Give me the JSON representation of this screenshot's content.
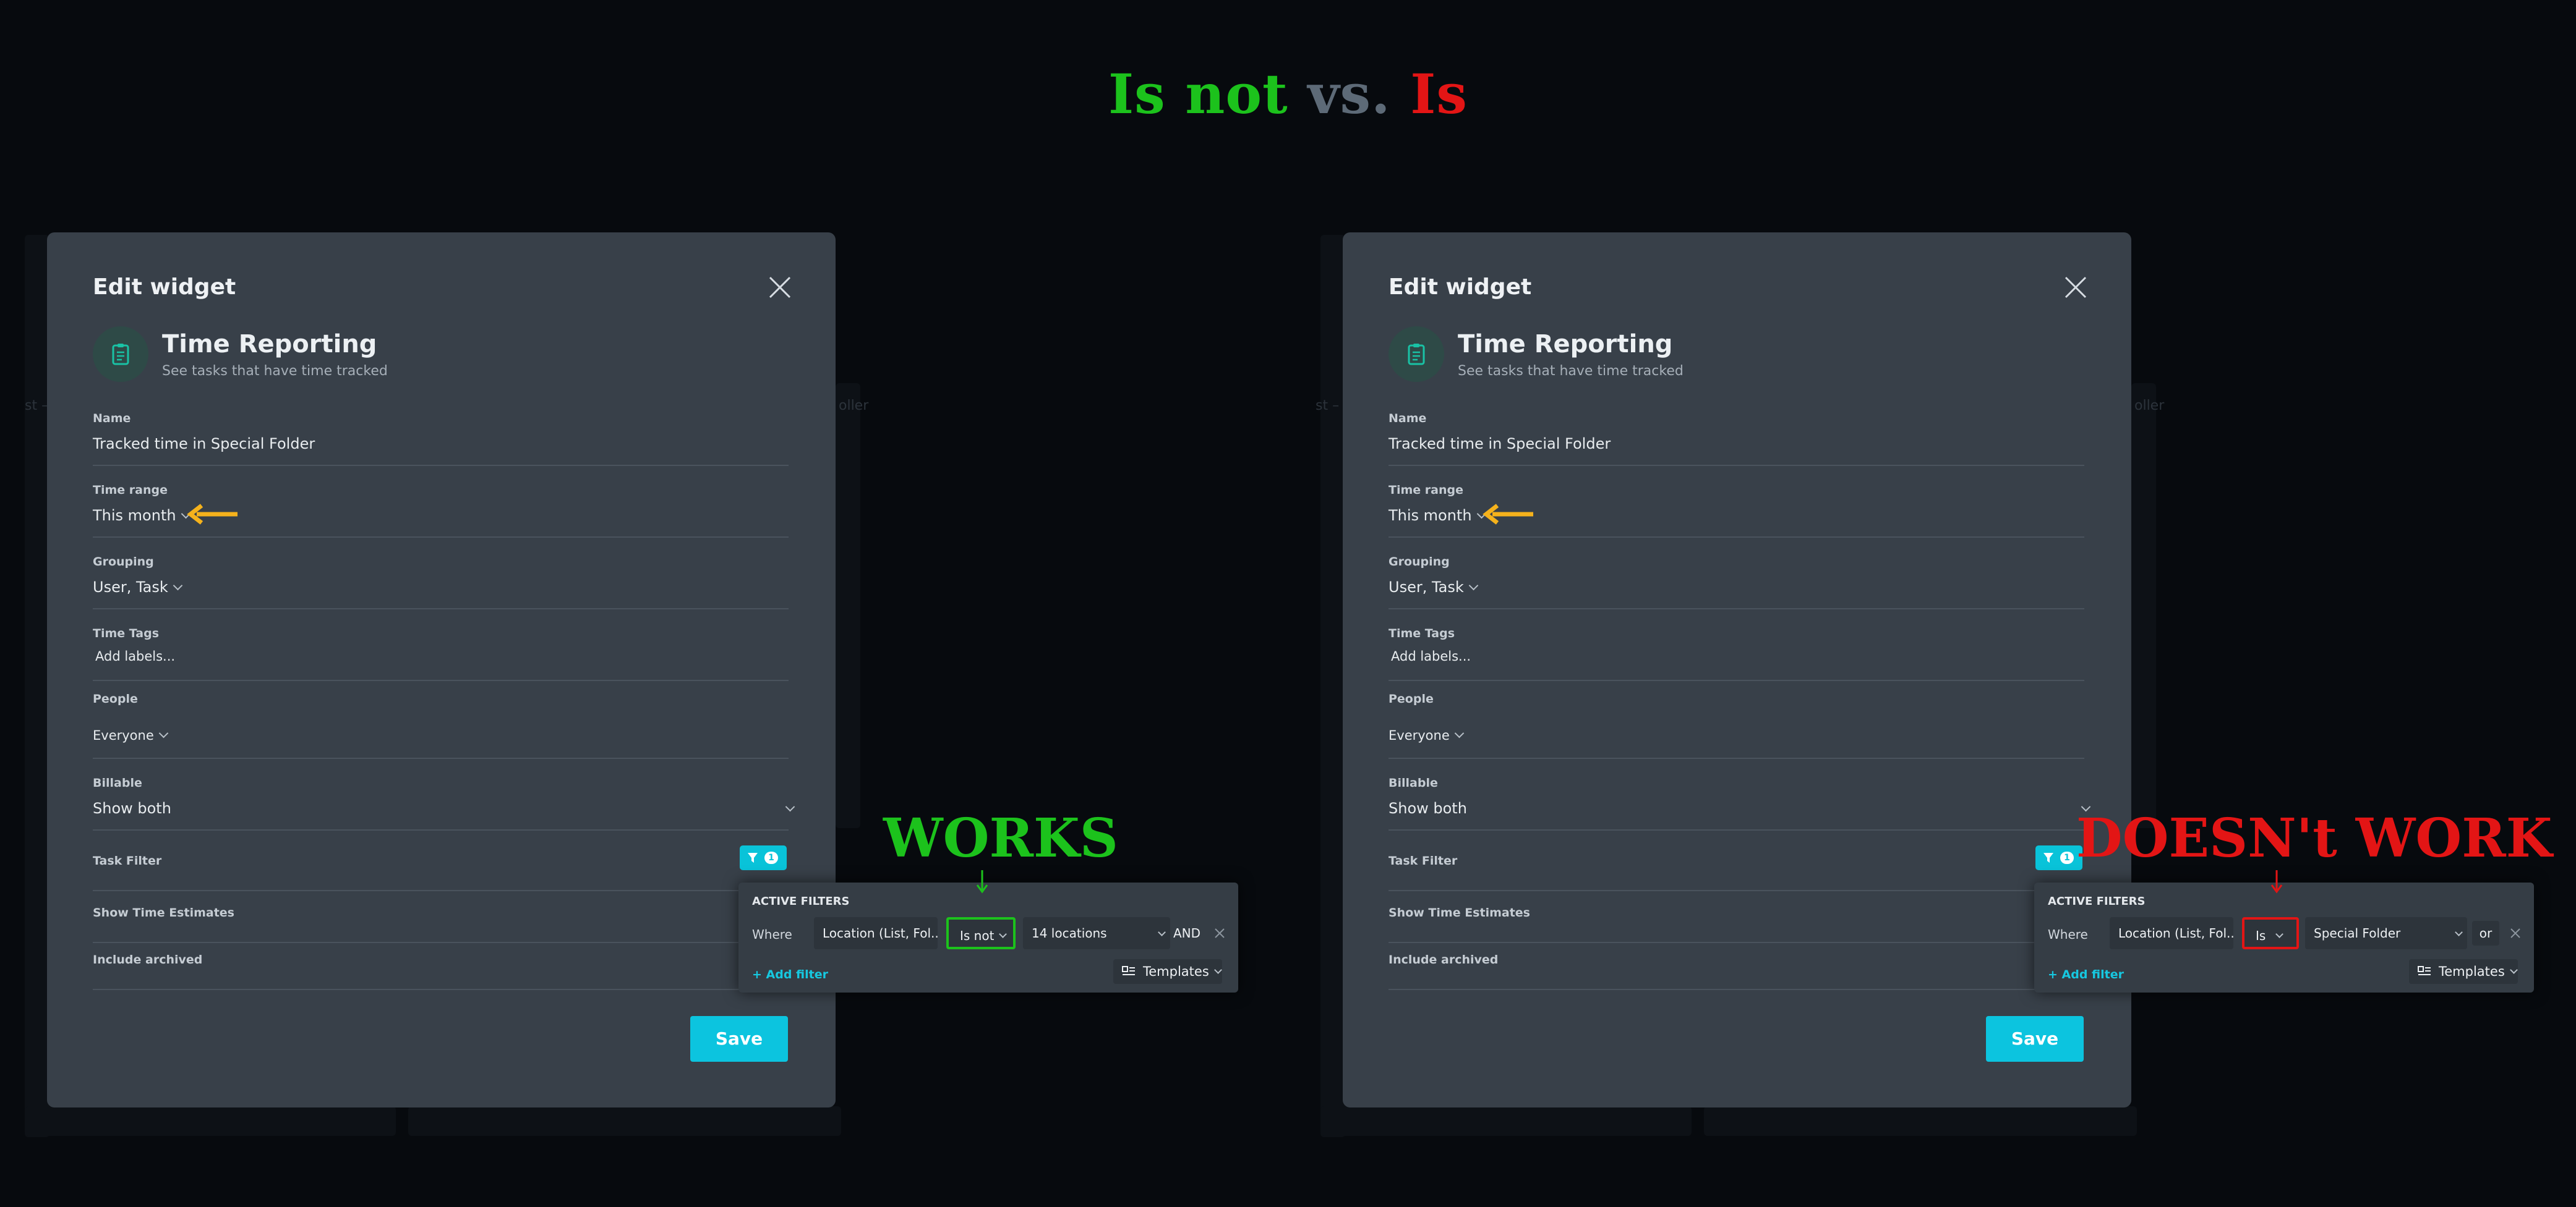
{
  "header": {
    "part1": "Is not",
    "part2": "vs.",
    "part3": "Is"
  },
  "colors": {
    "works": "#1cc21c",
    "doesnt_work": "#e31515",
    "accent": "#0cc4df",
    "arrow": "#f5b21c"
  },
  "background_fragments": [
    "st –",
    "oller"
  ],
  "panels": [
    {
      "annotation": "WORKS",
      "modal": {
        "title": "Edit widget",
        "widget_name": "Time Reporting",
        "widget_description": "See tasks that have time tracked",
        "fields": {
          "name_label": "Name",
          "name_value": "Tracked time in Special Folder",
          "time_range_label": "Time range",
          "time_range_value": "This month",
          "grouping_label": "Grouping",
          "grouping_value": "User, Task",
          "time_tags_label": "Time Tags",
          "time_tags_placeholder": "Add labels...",
          "people_label": "People",
          "people_value": "Everyone",
          "billable_label": "Billable",
          "billable_value": "Show both",
          "task_filter_label": "Task Filter",
          "task_filter_count": "1",
          "show_time_estimates_label": "Show Time Estimates",
          "include_archived_label": "Include archived"
        },
        "save_label": "Save"
      },
      "popup": {
        "header": "ACTIVE FILTERS",
        "where_label": "Where",
        "field_value": "Location (List, Fol...",
        "operator_value": "Is not",
        "value_value": "14 locations",
        "conjunction": "AND",
        "add_filter_label": "+ Add filter",
        "templates_label": "Templates"
      }
    },
    {
      "annotation": "DOESN't WORK",
      "modal": {
        "title": "Edit widget",
        "widget_name": "Time Reporting",
        "widget_description": "See tasks that have time tracked",
        "fields": {
          "name_label": "Name",
          "name_value": "Tracked time in Special Folder",
          "time_range_label": "Time range",
          "time_range_value": "This month",
          "grouping_label": "Grouping",
          "grouping_value": "User, Task",
          "time_tags_label": "Time Tags",
          "time_tags_placeholder": "Add labels...",
          "people_label": "People",
          "people_value": "Everyone",
          "billable_label": "Billable",
          "billable_value": "Show both",
          "task_filter_label": "Task Filter",
          "task_filter_count": "1",
          "show_time_estimates_label": "Show Time Estimates",
          "include_archived_label": "Include archived"
        },
        "save_label": "Save"
      },
      "popup": {
        "header": "ACTIVE FILTERS",
        "where_label": "Where",
        "field_value": "Location (List, Fol...",
        "operator_value": "Is",
        "value_value": "Special Folder",
        "conjunction": "or",
        "add_filter_label": "+ Add filter",
        "templates_label": "Templates"
      }
    }
  ]
}
